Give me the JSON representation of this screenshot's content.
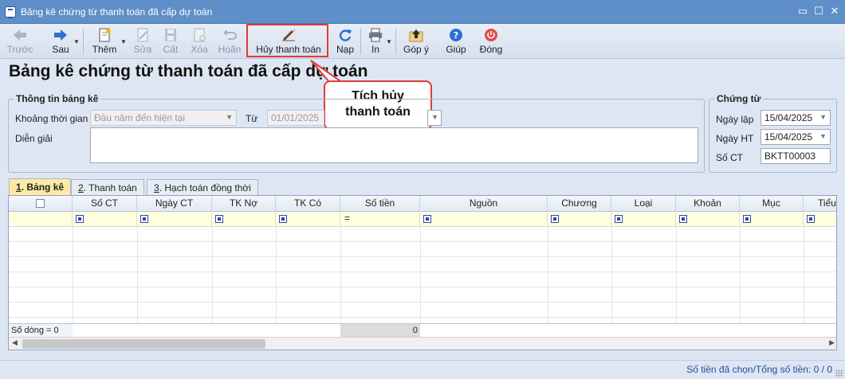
{
  "window": {
    "title": "Bảng kê chứng từ thanh toán đã cấp dự toán",
    "minimize_glyph": "▭",
    "maximize_glyph": "☐",
    "close_glyph": "✕"
  },
  "toolbar": {
    "prev": "Trước",
    "next": "Sau",
    "add": "Thêm",
    "edit": "Sửa",
    "save": "Cất",
    "delete": "Xóa",
    "undo": "Hoãn",
    "cancel_payment": "Hủy thanh toán",
    "reload": "Nạp",
    "print": "In",
    "feedback": "Góp ý",
    "help": "Giúp",
    "close": "Đóng"
  },
  "page": {
    "heading": "Bảng kê chứng từ thanh toán đã cấp dự toán"
  },
  "callout": {
    "line1": "Tích hủy",
    "line2": "thanh toán"
  },
  "info": {
    "group_title": "Thông tin bảng kê",
    "period_label": "Khoảng thời gian",
    "period_value": "Đầu năm đến hiện tại",
    "from_label": "Từ",
    "from_value": "01/01/2025",
    "desc_label": "Diễn giải",
    "desc_value": ""
  },
  "voucher": {
    "group_title": "Chứng từ",
    "date_label": "Ngày lập",
    "date_value": "15/04/2025",
    "post_date_label": "Ngày HT",
    "post_date_value": "15/04/2025",
    "number_label": "Số CT",
    "number_value": "BKTT00003"
  },
  "tabs": [
    {
      "key": "1",
      "label": ". Bảng kê"
    },
    {
      "key": "2",
      "label": ". Thanh toán"
    },
    {
      "key": "3",
      "label": ". Hạch toán đồng thời"
    }
  ],
  "grid": {
    "columns": [
      "Số CT",
      "Ngày CT",
      "TK Nợ",
      "TK Có",
      "Số tiền",
      "Nguồn",
      "Chương",
      "Loại",
      "Khoản",
      "Mục",
      "Tiểu"
    ],
    "row_count_label": "Số dòng = 0",
    "amount_total": "0",
    "filter_eq": "="
  },
  "status": {
    "summary": "Số tiền đã chọn/Tổng số tiền: 0 / 0"
  },
  "colors": {
    "title_bar": "#5f8fc8",
    "highlight": "#e03b3b",
    "active_tab": "#ffe9a6",
    "filter_row": "#ffffe0"
  }
}
